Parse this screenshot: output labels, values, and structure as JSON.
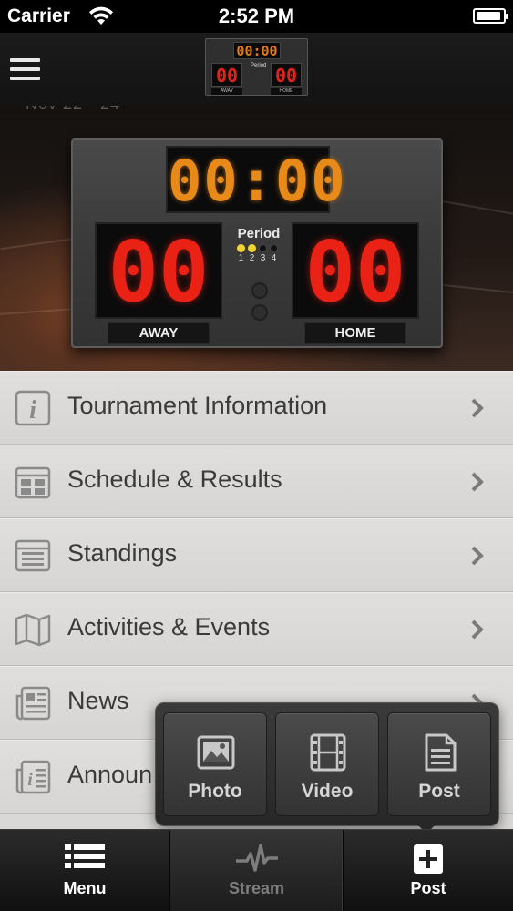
{
  "status_bar": {
    "carrier": "Carrier",
    "time": "2:52 PM"
  },
  "nav_bar": {
    "logo": {
      "time": "00:00",
      "away_score": "00",
      "home_score": "00",
      "period": "Period",
      "away_label": "AWAY",
      "home_label": "HOME"
    }
  },
  "hero": {
    "date_fragment": "Nov 22 - 24",
    "scoreboard": {
      "time": "00:00",
      "away_score": "00",
      "home_score": "00",
      "period_label": "Period",
      "period_numbers": [
        "1",
        "2",
        "3",
        "4"
      ],
      "periods_lit": 2,
      "away_label": "AWAY",
      "home_label": "HOME",
      "time_color": "#e88a1a",
      "score_color": "#ea2216",
      "period_lit_color": "#f2d430"
    }
  },
  "menu": {
    "items": [
      {
        "label": "Tournament Information",
        "icon": "info-icon"
      },
      {
        "label": "Schedule & Results",
        "icon": "calendar-icon"
      },
      {
        "label": "Standings",
        "icon": "list-icon"
      },
      {
        "label": "Activities & Events",
        "icon": "map-icon"
      },
      {
        "label": "News",
        "icon": "newspaper-icon"
      },
      {
        "label": "Announ",
        "icon": "announcement-icon"
      }
    ]
  },
  "post_popover": {
    "buttons": [
      {
        "label": "Photo",
        "icon": "photo-icon"
      },
      {
        "label": "Video",
        "icon": "film-icon"
      },
      {
        "label": "Post",
        "icon": "document-icon"
      }
    ]
  },
  "tab_bar": {
    "tabs": [
      {
        "label": "Menu",
        "icon": "menu-icon",
        "active": true
      },
      {
        "label": "Stream",
        "icon": "pulse-icon",
        "active": false
      },
      {
        "label": "Post",
        "icon": "plus-icon",
        "active": true
      }
    ]
  }
}
